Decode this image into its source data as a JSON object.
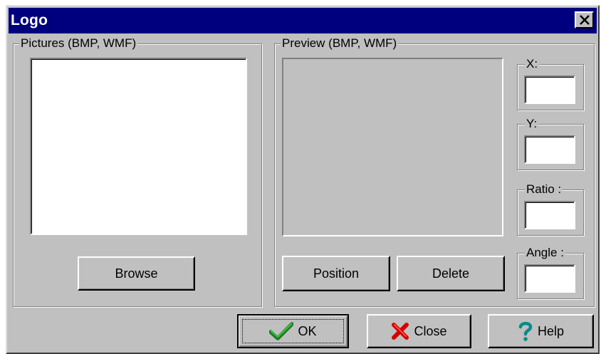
{
  "window": {
    "title": "Logo",
    "close_glyph": "✕",
    "colors": {
      "titlebar": "#00007f",
      "face": "#c0c0c0"
    }
  },
  "pictures": {
    "label": "Pictures (BMP, WMF)",
    "browse_label": "Browse"
  },
  "preview": {
    "label": "Preview (BMP, WMF)",
    "position_label": "Position",
    "delete_label": "Delete"
  },
  "fields": {
    "x_label": "X:",
    "x_value": "",
    "y_label": "Y:",
    "y_value": "",
    "ratio_label": "Ratio :",
    "ratio_value": "",
    "angle_label": "Angle :",
    "angle_value": ""
  },
  "buttons": {
    "ok_label": "OK",
    "ok_icon": "check-icon",
    "close_label": "Close",
    "close_icon": "red-x-icon",
    "help_label": "Help",
    "help_icon": "question-mark-icon"
  }
}
